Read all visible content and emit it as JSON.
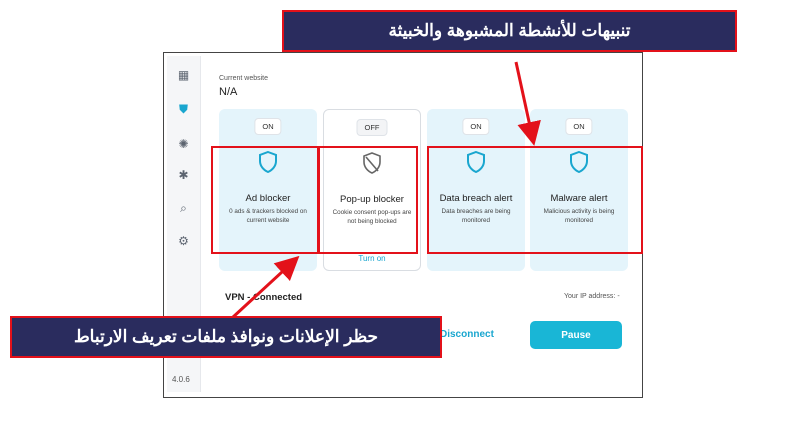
{
  "sidebar": {
    "icons": [
      "grid-icon",
      "shield-icon",
      "virus-icon",
      "bug-icon",
      "search-icon",
      "gear-icon"
    ],
    "active_index": 1,
    "version": "4.0.6"
  },
  "current_website": {
    "label": "Current website",
    "value": "N/A"
  },
  "cards": [
    {
      "status": "ON",
      "title": "Ad blocker",
      "desc": "0 ads & trackers blocked on current website",
      "link": ""
    },
    {
      "status": "OFF",
      "title": "Pop-up blocker",
      "desc": "Cookie consent pop-ups are not being blocked",
      "link": "Turn on"
    },
    {
      "status": "ON",
      "title": "Data breach alert",
      "desc": "Data breaches are being monitored",
      "link": ""
    },
    {
      "status": "ON",
      "title": "Malware alert",
      "desc": "Malicious activity is being monitored",
      "link": ""
    }
  ],
  "vpn": {
    "status": "VPN - Connected",
    "ip": "Your IP address: -",
    "disconnect": "Disconnect",
    "pause": "Pause"
  },
  "annotations": {
    "top": "تنبيهات للأنشطة المشبوهة والخبيثة",
    "bottom": "حظر الإعلانات ونوافذ ملفات تعريف الارتباط"
  },
  "colors": {
    "accent": "#19a6cf",
    "card_bg": "#e4f4fb",
    "callout_bg": "#2a2c5e",
    "highlight": "#e3111a"
  }
}
